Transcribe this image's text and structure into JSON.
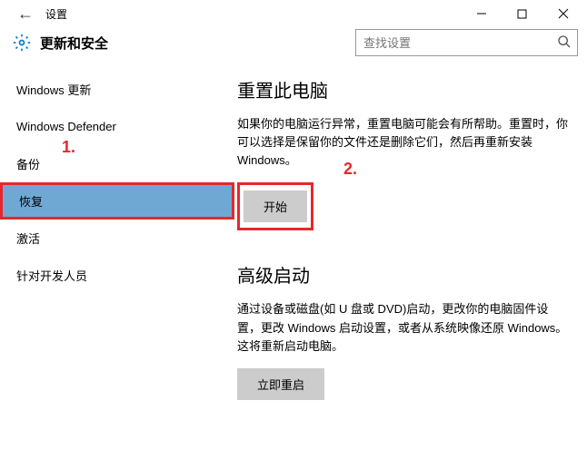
{
  "titlebar": {
    "back_glyph": "←",
    "title": "设置"
  },
  "header": {
    "page_title": "更新和安全",
    "search_placeholder": "查找设置"
  },
  "sidebar": {
    "items": [
      {
        "label": "Windows 更新"
      },
      {
        "label": "Windows Defender"
      },
      {
        "label": "备份"
      },
      {
        "label": "恢复"
      },
      {
        "label": "激活"
      },
      {
        "label": "针对开发人员"
      }
    ]
  },
  "content": {
    "reset": {
      "title": "重置此电脑",
      "desc": "如果你的电脑运行异常，重置电脑可能会有所帮助。重置时，你可以选择是保留你的文件还是删除它们，然后再重新安装 Windows。",
      "button": "开始"
    },
    "advanced": {
      "title": "高级启动",
      "desc": "通过设备或磁盘(如 U 盘或 DVD)启动，更改你的电脑固件设置，更改 Windows 启动设置，或者从系统映像还原 Windows。 这将重新启动电脑。",
      "button": "立即重启"
    }
  },
  "annotations": {
    "one": "1.",
    "two": "2."
  }
}
